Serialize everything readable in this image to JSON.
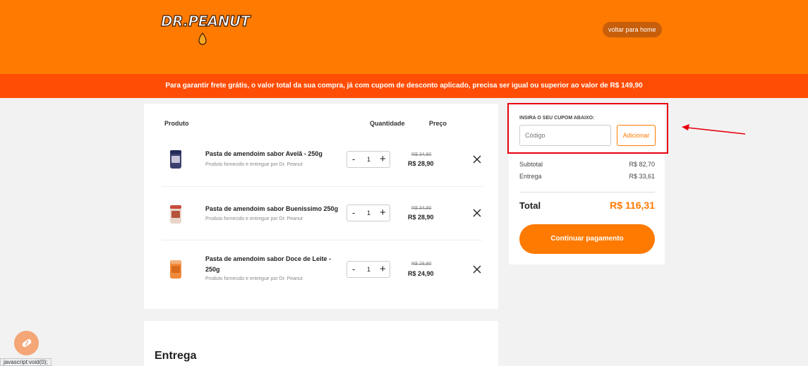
{
  "header": {
    "logo_text": "DR.PEANUT",
    "home_button": "voltar para home"
  },
  "banner": {
    "text": "Para garantir frete grátis, o valor total da sua compra, já com cupom de desconto aplicado, precisa ser igual ou superior ao valor de R$ 149,90"
  },
  "cart": {
    "columns": {
      "product": "Produto",
      "quantity": "Quantidade",
      "price": "Preço"
    },
    "items": [
      {
        "name": "Pasta de amendoim sabor Avelã - 250g",
        "seller": "Produto fornecido e entregue por Dr. Peanut",
        "qty": "1",
        "old_price": "R$ 34,90",
        "price": "R$ 28,90",
        "minus": "-",
        "plus": "+"
      },
      {
        "name": "Pasta de amendoim sabor Buenissimo 250g",
        "seller": "Produto fornecido e entregue por Dr. Peanut",
        "qty": "1",
        "old_price": "R$ 34,90",
        "price": "R$ 28,90",
        "minus": "-",
        "plus": "+"
      },
      {
        "name": "Pasta de amendoim sabor Doce de Leite - 250g",
        "seller": "Produto fornecido e entregue por Dr. Peanut",
        "qty": "1",
        "old_price": "R$ 28,90",
        "price": "R$ 24,90",
        "minus": "-",
        "plus": "+"
      }
    ]
  },
  "delivery": {
    "title": "Entrega"
  },
  "summary": {
    "coupon_title": "INSIRA O SEU CUPOM ABAIXO:",
    "coupon_placeholder": "Código",
    "coupon_button": "Adicionar",
    "subtotal_label": "Subtotal",
    "subtotal_value": "R$ 82,70",
    "shipping_label": "Entrega",
    "shipping_value": "R$ 33,61",
    "total_label": "Total",
    "total_value": "R$ 116,31",
    "pay_button": "Continuar pagamento"
  },
  "status_bar": {
    "url": "javascript:void(0);"
  },
  "colors": {
    "brand": "#ff7a00",
    "banner": "#ff4d06",
    "highlight": "#e8000f"
  },
  "icons": [
    "close-icon",
    "peanut-drop-icon",
    "red-arrow-icon",
    "chat-icon"
  ]
}
